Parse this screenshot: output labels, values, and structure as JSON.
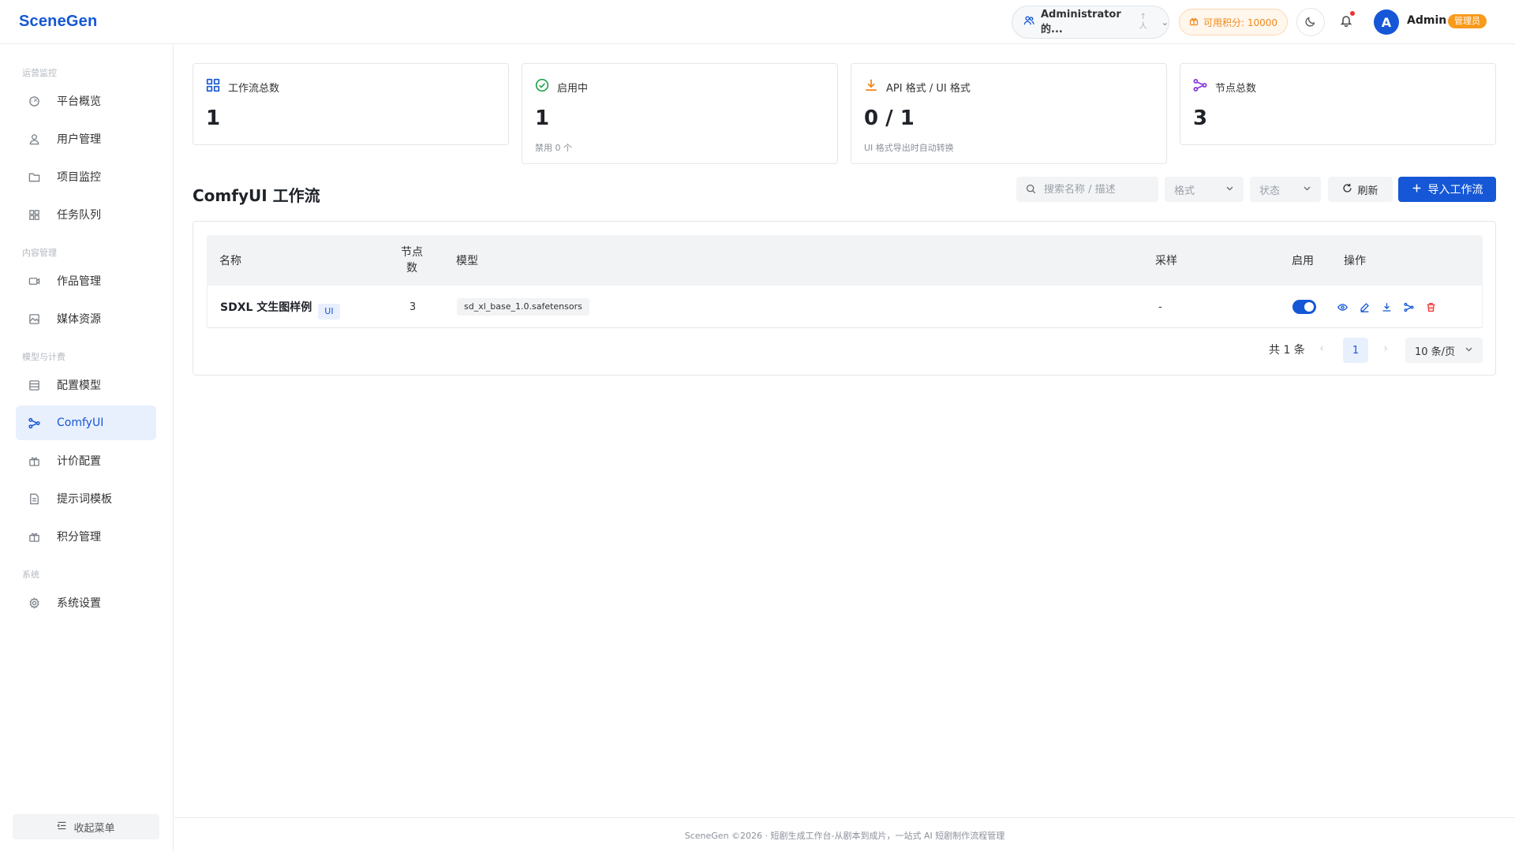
{
  "app": {
    "logo": "SceneGen"
  },
  "header": {
    "tenant_name": "Administrator 的...",
    "tenant_arrow_up": "↑",
    "tenant_arrow_person": "人",
    "points_label": "可用积分: 10000",
    "user_initial": "A",
    "user_name": "Admin",
    "role_badge": "管理员"
  },
  "sidebar": {
    "sections": [
      {
        "title": "运营监控",
        "items": [
          {
            "label": "平台概览",
            "icon": "dashboard-icon"
          },
          {
            "label": "用户管理",
            "icon": "user-icon"
          },
          {
            "label": "项目监控",
            "icon": "folder-icon"
          },
          {
            "label": "任务队列",
            "icon": "grid-icon"
          }
        ]
      },
      {
        "title": "内容管理",
        "items": [
          {
            "label": "作品管理",
            "icon": "video-icon"
          },
          {
            "label": "媒体资源",
            "icon": "image-icon"
          }
        ]
      },
      {
        "title": "模型与计费",
        "items": [
          {
            "label": "配置模型",
            "icon": "list-icon"
          },
          {
            "label": "ComfyUI",
            "icon": "workflow-icon",
            "active": true
          },
          {
            "label": "计价配置",
            "icon": "gift-icon"
          },
          {
            "label": "提示词模板",
            "icon": "document-icon"
          },
          {
            "label": "积分管理",
            "icon": "gift-icon"
          }
        ]
      },
      {
        "title": "系统",
        "items": [
          {
            "label": "系统设置",
            "icon": "gear-icon"
          }
        ]
      }
    ],
    "collapse_label": "收起菜单"
  },
  "stats": [
    {
      "label": "工作流总数",
      "value": "1",
      "sub": "",
      "icon": "grid-icon"
    },
    {
      "label": "启用中",
      "value": "1",
      "sub": "禁用 0 个",
      "icon": "check-circle-icon"
    },
    {
      "label": "API 格式 / UI 格式",
      "value": "0 / 1",
      "sub": "UI 格式导出时自动转换",
      "icon": "download-icon"
    },
    {
      "label": "节点总数",
      "value": "3",
      "sub": "",
      "icon": "workflow-icon"
    }
  ],
  "colors": {
    "primary": "#1557d6",
    "success": "#22a54a",
    "warning": "#f08a1d",
    "purple": "#8b3fd9",
    "danger": "#f23030"
  },
  "main": {
    "title": "ComfyUI 工作流",
    "search_placeholder": "搜索名称 / 描述",
    "format_placeholder": "格式",
    "status_placeholder": "状态",
    "refresh_label": "刷新",
    "import_label": "导入工作流"
  },
  "table": {
    "columns": {
      "name": "名称",
      "nodes": "节点数",
      "model": "模型",
      "sampler": "采样",
      "enabled": "启用",
      "actions": "操作"
    },
    "rows": [
      {
        "name": "SDXL 文生图样例",
        "tag": "UI",
        "nodes": "3",
        "model": "sd_xl_base_1.0.safetensors",
        "sampler": "-",
        "enabled": true
      }
    ]
  },
  "pagination": {
    "total": "共 1 条",
    "current": "1",
    "page_size": "10 条/页"
  },
  "footer": {
    "text": "SceneGen ©2026 · 短剧生成工作台-从剧本到成片，一站式 AI 短剧制作流程管理"
  }
}
